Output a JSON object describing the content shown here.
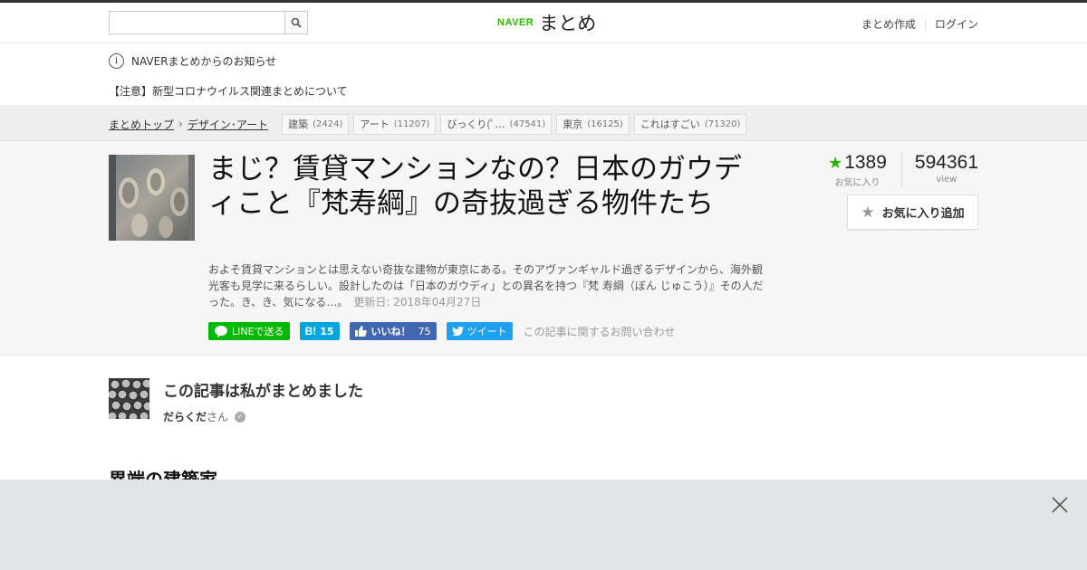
{
  "header": {
    "search_placeholder": "",
    "logo_brand": "NAVER",
    "logo_text": "まとめ",
    "links": [
      "まとめ作成",
      "ログイン"
    ]
  },
  "notice": {
    "title": "NAVERまとめからのお知らせ",
    "item": "【注意】新型コロナウイルス関連まとめについて"
  },
  "breadcrumb": {
    "top": "まとめトップ",
    "category": "デザイン･アート"
  },
  "tags": [
    {
      "label": "建築",
      "count": "(2424)"
    },
    {
      "label": "アート",
      "count": "(11207)"
    },
    {
      "label": "びっくり(ﾟ…",
      "count": "(47541)"
    },
    {
      "label": "東京",
      "count": "(16125)"
    },
    {
      "label": "これはすごい",
      "count": "(71320)"
    }
  ],
  "article": {
    "title": "まじ？賃貸マンションなの？日本のガウディこと『梵寿綱』の奇抜過ぎる物件たち",
    "description": "およそ賃貸マンションとは思えない奇抜な建物が東京にある。そのアヴァンギャルド過ぎるデザインから、海外観光客も見学に来るらしい。設計したのは「日本のガウディ」との異名を持つ『梵 寿綱（ぼん じゅこう）』その人だった。き、き、気になる…。",
    "updated": "更新日: 2018年04月27日",
    "favorites": "1389",
    "favorites_label": "お気に入り",
    "views": "594361",
    "views_label": "view",
    "fav_button": "お気に入り追加",
    "contact": "この記事に関するお問い合わせ"
  },
  "share": {
    "line": "LINEで送る",
    "hatena_count": "15",
    "fb_label": "いいね！",
    "fb_count": "75",
    "tweet": "ツイート"
  },
  "author": {
    "heading": "この記事は私がまとめました",
    "name": "だらくだ",
    "suffix": "さん"
  },
  "section": {
    "title": "異端の建築家"
  },
  "colors": {
    "brand_green": "#2db400",
    "line_green": "#00b900",
    "hatena_blue": "#00a4de",
    "facebook_blue": "#4267b2",
    "twitter_blue": "#1da1f2"
  }
}
